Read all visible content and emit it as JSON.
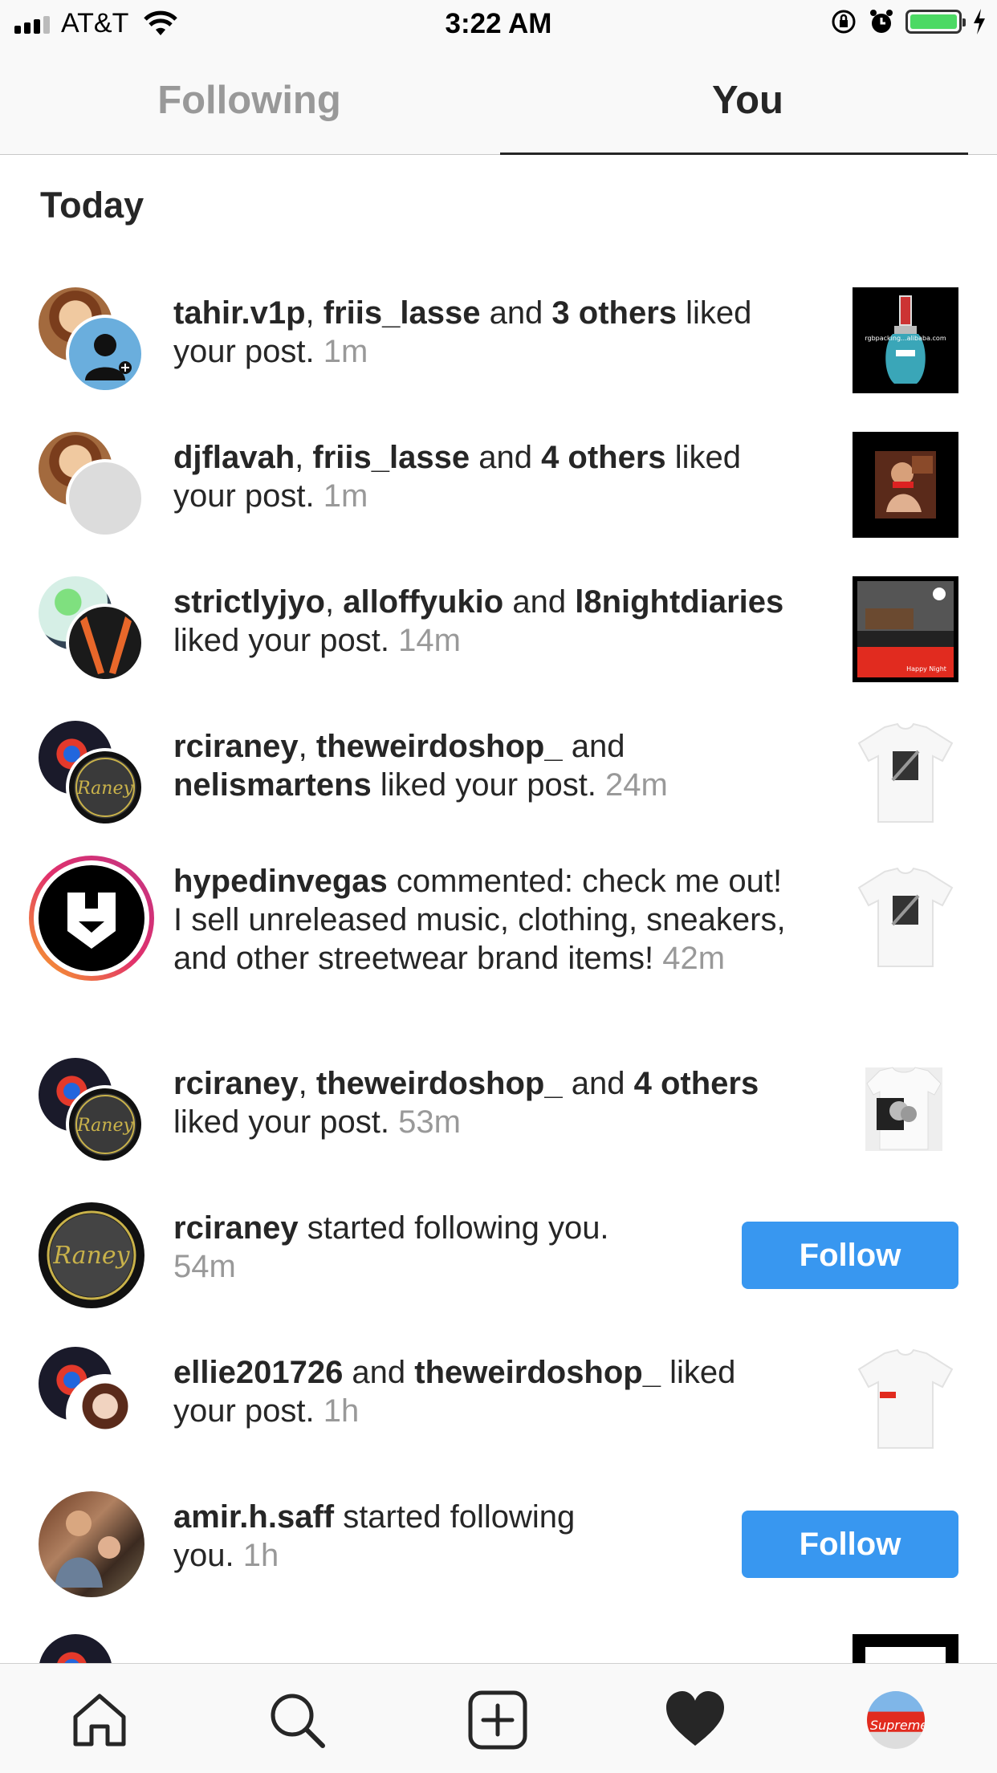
{
  "status": {
    "carrier": "AT&T",
    "time": "3:22 AM",
    "battery_color": "#4cd964"
  },
  "tabs": [
    {
      "label": "Following"
    },
    {
      "label": "You"
    }
  ],
  "section": {
    "title": "Today"
  },
  "notifications": [
    {
      "user1": "tahir.v1p",
      "sep1": ", ",
      "user2": "friis_lasse",
      "mid": " and ",
      "others": "3 others",
      "action": " liked your post. ",
      "time": "1m"
    },
    {
      "user1": "djflavah",
      "sep1": ", ",
      "user2": "friis_lasse",
      "mid": " and ",
      "others": "4 others",
      "action": " liked your post. ",
      "time": "1m"
    },
    {
      "user1": "strictlyjyo",
      "sep1": ", ",
      "user2": "alloffyukio",
      "mid": " and ",
      "user3": "l8nightdiaries",
      "action": " liked your post. ",
      "time": "14m"
    },
    {
      "user1": "rciraney",
      "sep1": ", ",
      "user2": "theweirdoshop_",
      "mid": " and ",
      "user3": "nelismartens",
      "action": " liked your post. ",
      "time": "24m"
    },
    {
      "user1": "hypedinvegas",
      "action": " commented: check me out! I sell unreleased music, clothing, sneakers, and other streetwear brand items! ",
      "time": "42m"
    },
    {
      "user1": "rciraney",
      "sep1": ", ",
      "user2": "theweirdoshop_",
      "mid": " and ",
      "others": "4 others",
      "action": " liked your post. ",
      "time": "53m"
    },
    {
      "user1": "rciraney",
      "action": " started following you. ",
      "time": "54m",
      "button": "Follow"
    },
    {
      "user1": "ellie201726",
      "mid": " and ",
      "user2": "theweirdoshop_",
      "action": " liked your post. ",
      "time": "1h"
    },
    {
      "user1": "amir.h.saff",
      "action": " started following you. ",
      "time": "1h",
      "button": "Follow"
    }
  ],
  "thumb_texts": {
    "alibaba": "rgbpacking...alibaba.com",
    "promo": "Happy Night",
    "brand": "Supreme"
  },
  "avatar_texts": {
    "raney": "Raney"
  },
  "accent_color": "#3897f0",
  "bottom_nav": [
    {
      "icon": "home-icon"
    },
    {
      "icon": "search-icon"
    },
    {
      "icon": "add-post-icon"
    },
    {
      "icon": "heart-icon"
    },
    {
      "icon": "profile-avatar"
    }
  ]
}
